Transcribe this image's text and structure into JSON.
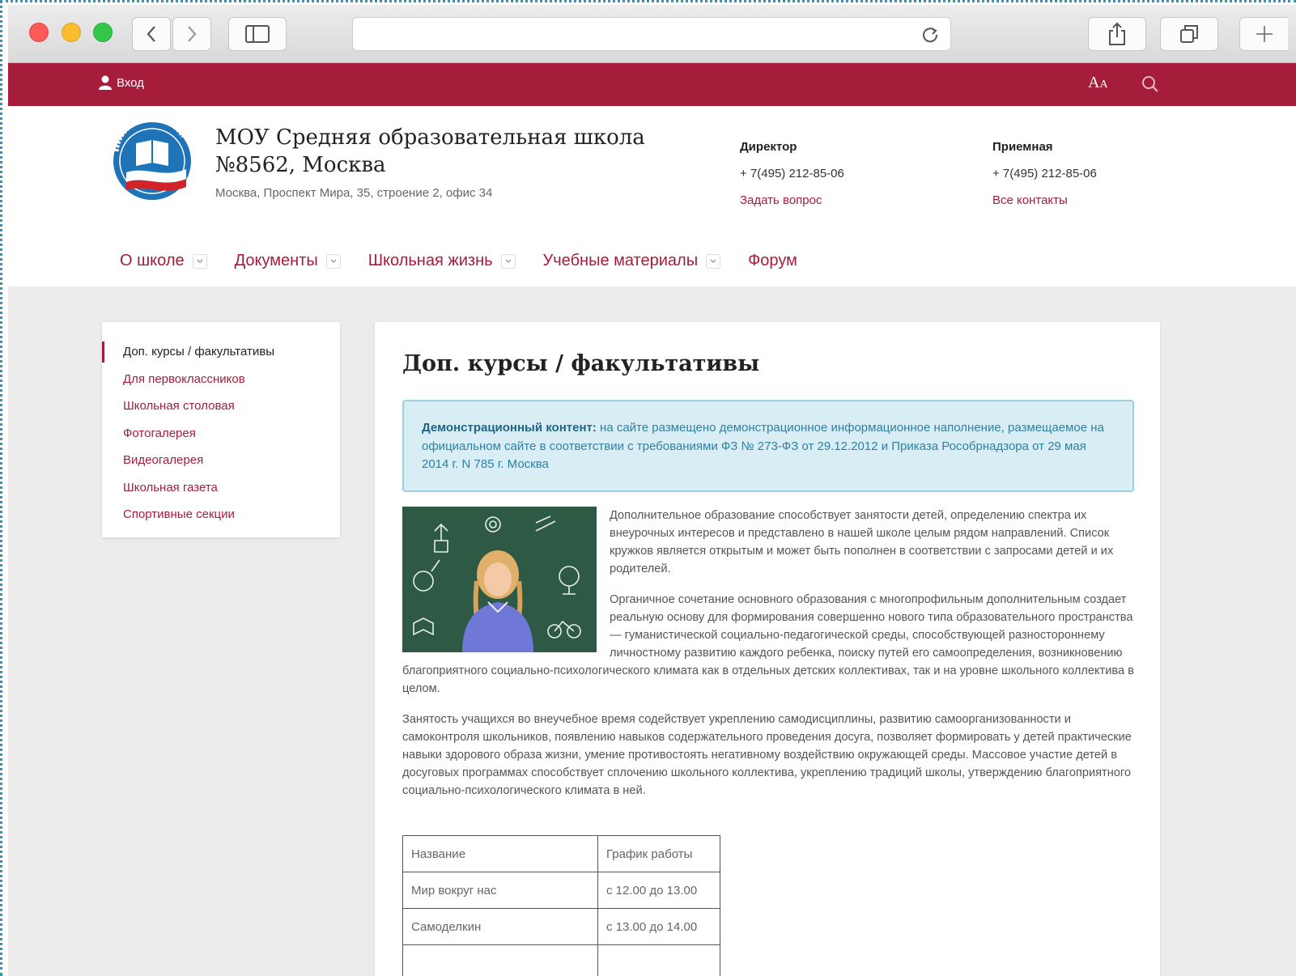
{
  "topbar": {
    "login_label": "Вход",
    "fontsize_big": "A",
    "fontsize_small": "A"
  },
  "header": {
    "school_name": "МОУ Средняя образовательная школа №8562, Москва",
    "address": "Москва, Проспект Мира, 35, строение 2, офис 34",
    "director": {
      "title": "Директор",
      "phone": "+ 7(495) 212-85-06",
      "link": "Задать вопрос"
    },
    "reception": {
      "title": "Приемная",
      "phone": "+ 7(495) 212-85-06",
      "link": "Все контакты"
    }
  },
  "nav": {
    "items": [
      {
        "label": "О школе"
      },
      {
        "label": "Документы"
      },
      {
        "label": "Школьная жизнь"
      },
      {
        "label": "Учебные материалы"
      },
      {
        "label": "Форум"
      }
    ]
  },
  "sidebar": {
    "items": [
      {
        "label": "Доп. курсы / факультативы"
      },
      {
        "label": "Для первоклассников"
      },
      {
        "label": "Школьная столовая"
      },
      {
        "label": "Фотогалерея"
      },
      {
        "label": "Видеогалерея"
      },
      {
        "label": "Школьная газета"
      },
      {
        "label": "Спортивные секции"
      }
    ]
  },
  "content": {
    "title": "Доп. курсы / факультативы",
    "notice_bold": "Демонстрационный контент:",
    "notice_text": "на сайте размещено демонстрационное информационное наполнение, размещаемое на официальном сайте в соответствии с требованиями ФЗ № 273-ФЗ от 29.12.2012 и Приказа Рособрнадзора от 29 мая 2014 г. N 785 г. Москва",
    "paragraphs": [
      "Дополнительное образование способствует занятости детей, определению спектра их внеурочных интересов и представлено в нашей школе целым рядом направлений. Список кружков является открытым и может быть пополнен в соответствии с запросами детей и их родителей.",
      "Органичное сочетание основного образования с многопрофильным дополнительным создает реальную основу для формирования совершенно нового типа образовательного пространства — гуманистической социально-педагогической среды, способствующей разностороннему личностному развитию каждого ребенка, поиску путей его самоопределения, возникновению благоприятного социально-психологического климата как в отдельных детских коллективах, так и на уровне школьного коллектива в целом.",
      "Занятость учащихся во внеучебное время содействует укреплению самодисциплины, развитию самоорганизованности и самоконтроля школьников, появлению навыков содержательного проведения досуга, позволяет формировать у детей практические навыки здорового образа жизни, умение противостоять негативному воздействию окружающей среды. Массовое участие детей в досуговых программах способствует сплочению школьного коллектива, укреплению традиций школы, утверждению благоприятного социально-психологического климата в ней."
    ],
    "table": {
      "headers": [
        "Название",
        "График работы"
      ],
      "rows": [
        [
          "Мир вокруг нас",
          "с 12.00 до 13.00"
        ],
        [
          "Самоделкин",
          "с 13.00 до 14.00"
        ],
        [
          "",
          ""
        ]
      ]
    }
  },
  "colors": {
    "brand": "#a51d3a",
    "notice_bg": "#d9eef4",
    "page_bg": "#ececec"
  }
}
